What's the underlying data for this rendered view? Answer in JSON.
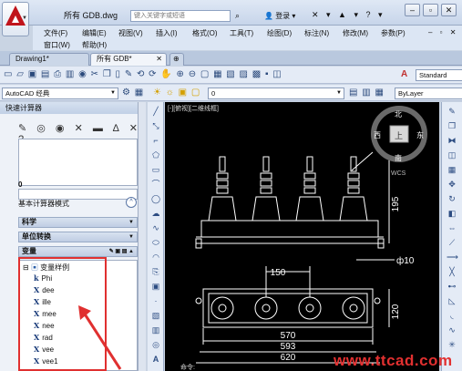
{
  "window": {
    "title": "所有 GDB.dwg",
    "search_placeholder": "键入关键字或短语",
    "login": "登录",
    "controls": [
      "–",
      "▫",
      "✕"
    ]
  },
  "menu": {
    "row1": [
      "文件(F)",
      "编辑(E)",
      "视图(V)",
      "插入(I)",
      "格式(O)",
      "工具(T)",
      "绘图(D)",
      "标注(N)",
      "修改(M)",
      "参数(P)"
    ],
    "row2": [
      "窗口(W)",
      "帮助(H)"
    ],
    "doc_controls": "– ▫ ✕"
  },
  "tabs": [
    {
      "label": "Drawing1*",
      "active": false
    },
    {
      "label": "所有 GDB*",
      "active": true
    }
  ],
  "toolbar": {
    "workspace": "AutoCAD 经典",
    "layer": "0",
    "textstyle": "Standard",
    "linetype": "ByLayer"
  },
  "calculator": {
    "title": "快速计算器",
    "result_value": "0",
    "mode_label": "基本计算器模式",
    "mode_toggle": "^",
    "sections": [
      "科学",
      "单位转换",
      "变量"
    ],
    "tree_root": "变量样例",
    "variables": [
      "Phi",
      "dee",
      "ille",
      "mee",
      "nee",
      "rad",
      "vee",
      "vee1"
    ]
  },
  "canvas": {
    "viewport_label": "[-][俯视][二维线框]",
    "viewcube_top": "上",
    "compass_n": "北",
    "compass_s": "南",
    "compass_w": "西",
    "compass_e": "东",
    "wcs": "WCS",
    "dims": [
      "150",
      "570",
      "593",
      "620",
      "195",
      "120",
      "ф10"
    ],
    "command_label": "命令:"
  },
  "watermark": "www.ttcad.com",
  "colors": {
    "highlight": "#e03030",
    "canvas_bg": "#000000",
    "brand_red": "#c0141b"
  }
}
